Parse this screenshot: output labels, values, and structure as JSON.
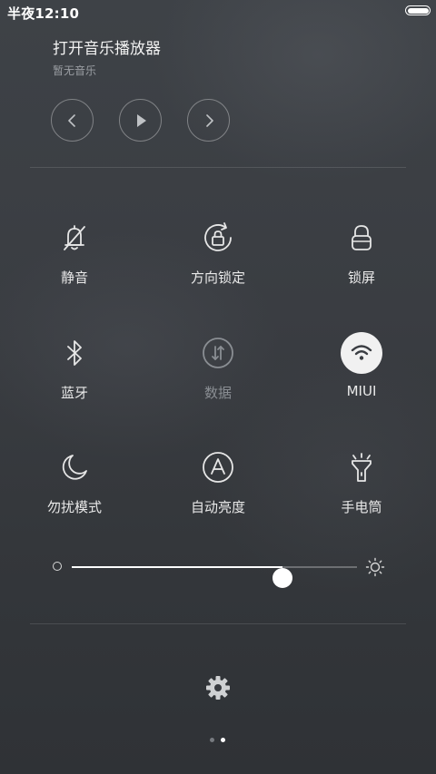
{
  "status_bar": {
    "time": "半夜12:10",
    "battery_level": 1.0
  },
  "music": {
    "title": "打开音乐播放器",
    "subtitle": "暂无音乐",
    "controls": [
      "previous-icon",
      "play-icon",
      "next-icon"
    ]
  },
  "toggles": [
    {
      "label": "静音",
      "icon": "bell-muted-icon",
      "state": "off"
    },
    {
      "label": "方向锁定",
      "icon": "rotation-lock-icon",
      "state": "off"
    },
    {
      "label": "锁屏",
      "icon": "lock-icon",
      "state": "off"
    },
    {
      "label": "蓝牙",
      "icon": "bluetooth-icon",
      "state": "off"
    },
    {
      "label": "数据",
      "icon": "mobile-data-icon",
      "state": "disabled"
    },
    {
      "label": "MIUI",
      "icon": "wifi-icon",
      "state": "on"
    },
    {
      "label": "勿扰模式",
      "icon": "moon-icon",
      "state": "off"
    },
    {
      "label": "自动亮度",
      "icon": "auto-brightness-icon",
      "state": "off"
    },
    {
      "label": "手电筒",
      "icon": "flashlight-icon",
      "state": "off"
    }
  ],
  "brightness": {
    "level": 0.74
  },
  "settings": {
    "icon": "gear-icon"
  },
  "pager": {
    "count": 2,
    "active_index": 1
  },
  "colors": {
    "icon": "#e6e6e6",
    "icon_disabled": "#8a8e93",
    "active_bg": "#f1f1f1",
    "active_fg": "#3a3d42",
    "dot_active": "#ffffff",
    "dot_inactive": "#777b80"
  }
}
